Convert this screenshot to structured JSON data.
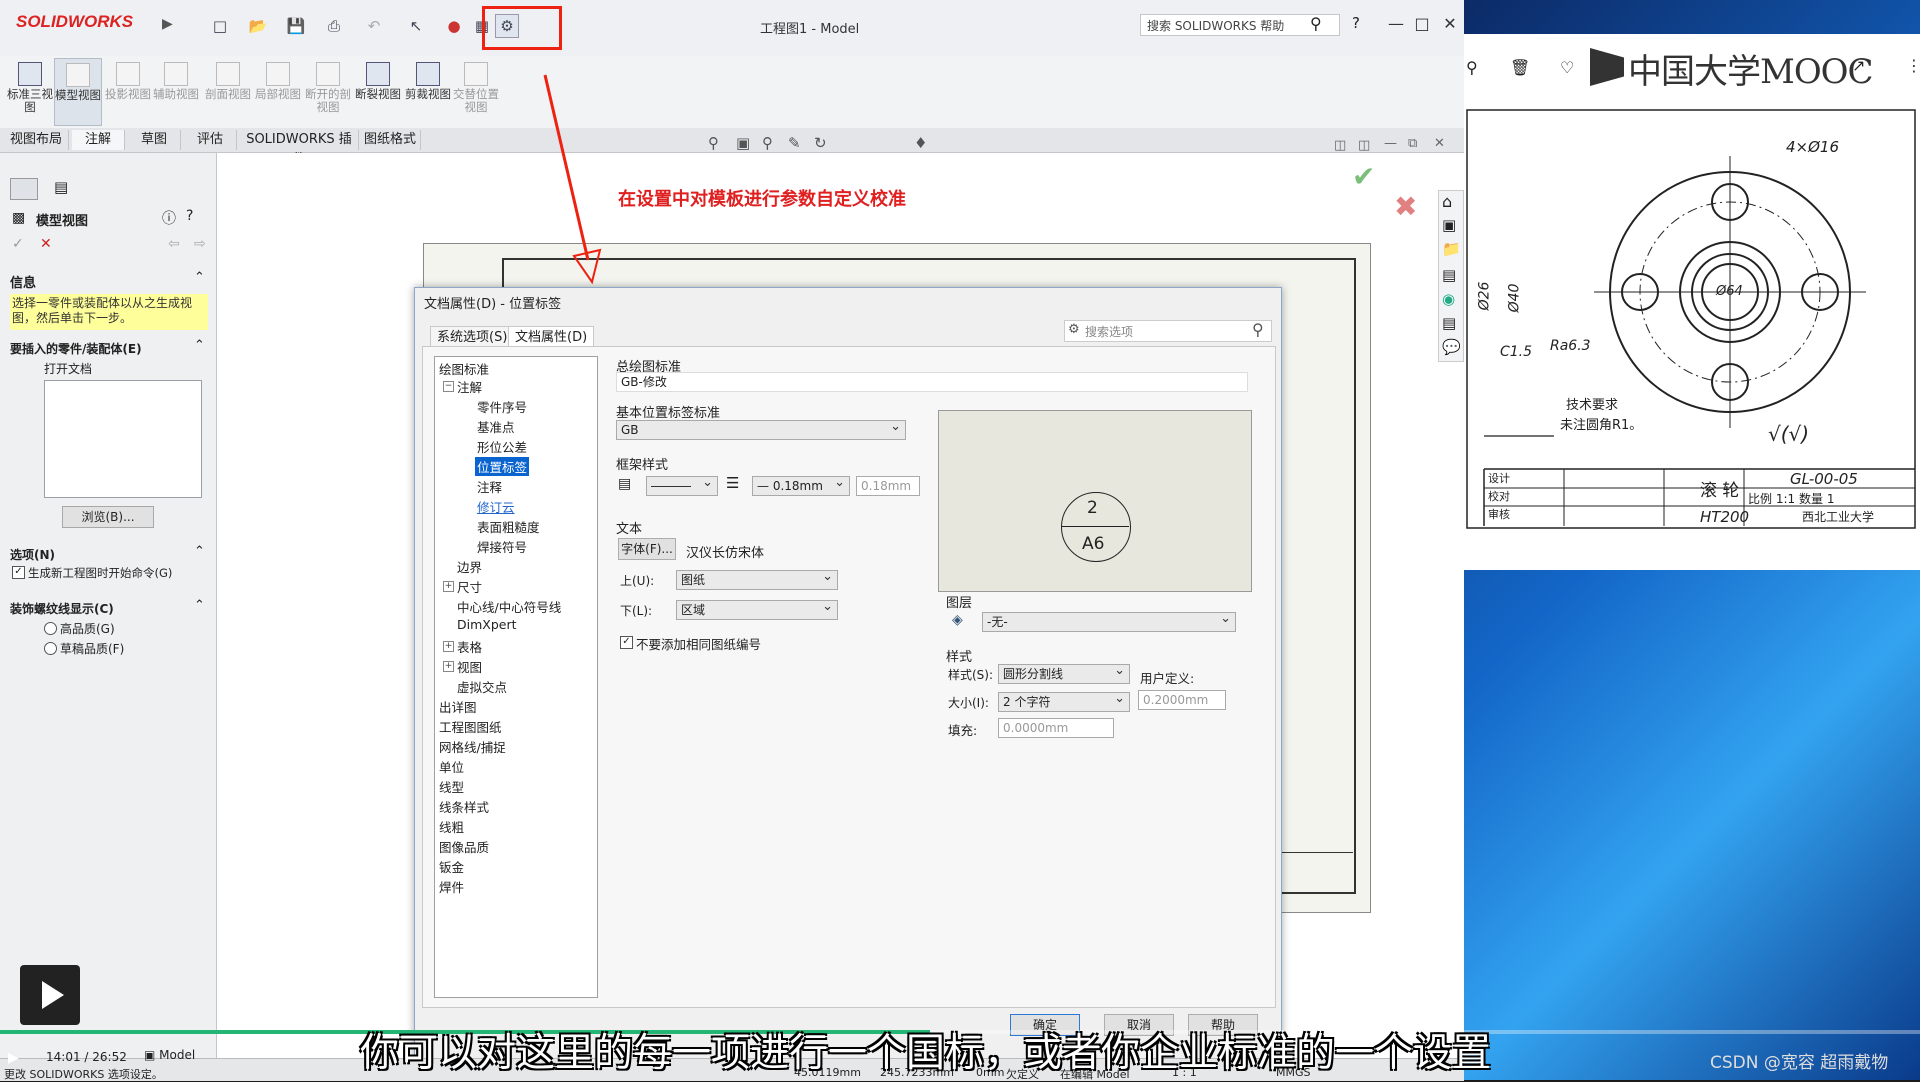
{
  "app": {
    "logo": "SOLIDWORKS",
    "window_title": "工程图1 - Model",
    "help_search_placeholder": "搜索 SOLIDWORKS 帮助"
  },
  "ribbon": {
    "commands": [
      "标准三视图",
      "模型视图",
      "投影视图",
      "辅助视图",
      "剖面视图",
      "局部视图",
      "断开的剖视图",
      "断裂视图",
      "剪裁视图",
      "交替位置视图"
    ],
    "tabs": [
      "视图布局",
      "注解",
      "草图",
      "评估",
      "SOLIDWORKS 插件",
      "图纸格式"
    ]
  },
  "left_panel": {
    "title": "模型视图",
    "info_header": "信息",
    "info_text": "选择一零件或装配体以从之生成视图，然后单击下一步。",
    "insert_header": "要插入的零件/装配体(E)",
    "open_docs_label": "打开文档",
    "browse_button": "浏览(B)...",
    "options_header": "选项(N)",
    "options_checkbox": "生成新工程图时开始命令(G)",
    "thread_header": "装饰螺纹线显示(C)",
    "thread_high": "高品质(G)",
    "thread_draft": "草稿品质(F)"
  },
  "annotation": {
    "callout": "在设置中对模板进行参数自定义校准"
  },
  "dialog": {
    "title": "文档属性(D) - 位置标签",
    "tab_system": "系统选项(S)",
    "tab_document": "文档属性(D)",
    "search_placeholder": "搜索选项",
    "tree": [
      "绘图标准",
      "注解",
      "零件序号",
      "基准点",
      "形位公差",
      "位置标签",
      "注释",
      "修订云",
      "表面粗糙度",
      "焊接符号",
      "边界",
      "尺寸",
      "中心线/中心符号线",
      "DimXpert",
      "表格",
      "视图",
      "虚拟交点",
      "出详图",
      "工程图图纸",
      "网格线/捕捉",
      "单位",
      "线型",
      "线条样式",
      "线粗",
      "图像品质",
      "钣金",
      "焊件"
    ],
    "overall_standard_label": "总绘图标准",
    "overall_standard_value": "GB-修改",
    "base_standard_label": "基本位置标签标准",
    "base_standard_value": "GB",
    "frame_style_label": "框架样式",
    "line_weight": "0.18mm",
    "line_weight_custom": "0.18mm",
    "text_label": "文本",
    "font_button": "字体(F)...",
    "font_name": "汉仪长仿宋体",
    "upper_label": "上(U):",
    "upper_value": "图纸",
    "lower_label": "下(L):",
    "lower_value": "区域",
    "no_same_sheet_checkbox": "不要添加相同图纸编号",
    "preview_top": "2",
    "preview_bottom": "A6",
    "layer_label": "图层",
    "layer_value": "-无-",
    "style_section_label": "样式",
    "style_label": "样式(S):",
    "style_value": "圆形分割线",
    "size_label": "大小(I):",
    "size_value": "2 个字符",
    "user_defined_label": "用户定义:",
    "user_defined_value": "0.2000mm",
    "fill_label": "填充:",
    "fill_value": "0.0000mm",
    "ok_button": "确定",
    "cancel_button": "取消",
    "help_button": "帮助"
  },
  "mooc": {
    "logo": "中国大学MOOC",
    "drawing_notes": [
      "4×Ø16",
      "Ø26",
      "Ø40",
      "Ø64",
      "C1.5",
      "Ra6.3",
      "技术要求",
      "未注圆角R1。"
    ],
    "title_block": {
      "name": "滚 轮",
      "code": "GL-00-05",
      "scale_label": "比例",
      "scale": "1:1",
      "qty_label": "数量",
      "qty": "1",
      "material": "HT200",
      "school": "西北工业大学",
      "rows": [
        "设计",
        "校对",
        "审核"
      ]
    }
  },
  "player": {
    "subtitle": "你可以对这里的每一项进行一个国标，或者你企业标准的一个设置",
    "time": "14:01 / 26:52",
    "watermark": "CSDN @宽容 超雨戴物"
  },
  "status": {
    "left_text": "更改 SOLIDWORKS 选项设定。",
    "x": "45.0119mm",
    "y": "245.7233mm",
    "z": "0mm",
    "state": "欠定义",
    "mode": "在编辑 Model",
    "scale": "1 : 1",
    "units": "MMGS",
    "tab_model": "Model"
  }
}
